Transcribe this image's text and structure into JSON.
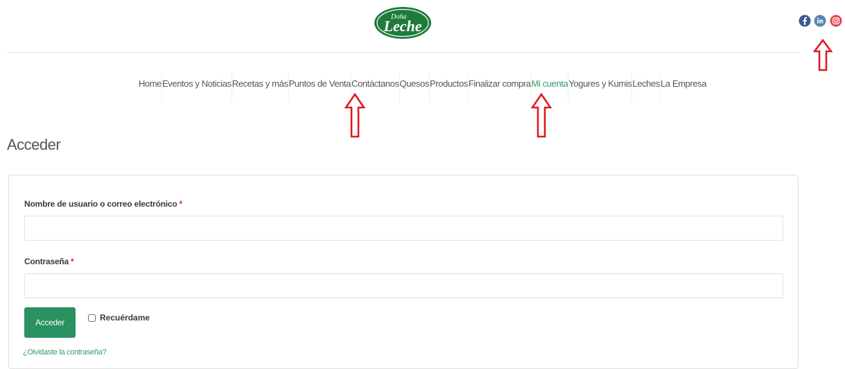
{
  "header": {
    "logo": {
      "text_small": "Doña",
      "text_main": "Leche",
      "icon": "dona-leche-logo-icon",
      "color": "#1f7a3c"
    },
    "social": [
      {
        "icon": "facebook-icon",
        "color": "#3b5998"
      },
      {
        "icon": "linkedin-icon",
        "color": "#0077b5"
      },
      {
        "icon": "instagram-icon",
        "color": "#e1306c"
      }
    ]
  },
  "nav": {
    "items": [
      {
        "label": "Home"
      },
      {
        "label": "Eventos y Noticias"
      },
      {
        "label": "Recetas y más"
      },
      {
        "label": "Puntos de Venta"
      },
      {
        "label": "Contáctanos"
      },
      {
        "label": "Quesos"
      },
      {
        "label": "Productos"
      },
      {
        "label": "Finalizar compra"
      },
      {
        "label": "Mi cuenta",
        "active": true
      },
      {
        "label": "Yogures y Kumis"
      },
      {
        "label": "Leches"
      },
      {
        "label": "La Empresa"
      }
    ]
  },
  "page": {
    "title": "Acceder"
  },
  "login": {
    "username_label": "Nombre de usuario o correo electrónico",
    "password_label": "Contraseña",
    "required_mark": "*",
    "submit_label": "Acceder",
    "remember_label": "Recuérdame",
    "lost_password_label": "¿Olvidaste la contraseña?",
    "username_value": "",
    "password_value": ""
  },
  "annotations": {
    "arrow_icon": "red-up-arrow-icon",
    "arrow_color": "#e0191f"
  },
  "colors": {
    "accent": "#2e9e63",
    "button": "#2a9161",
    "required": "#d6262c"
  }
}
